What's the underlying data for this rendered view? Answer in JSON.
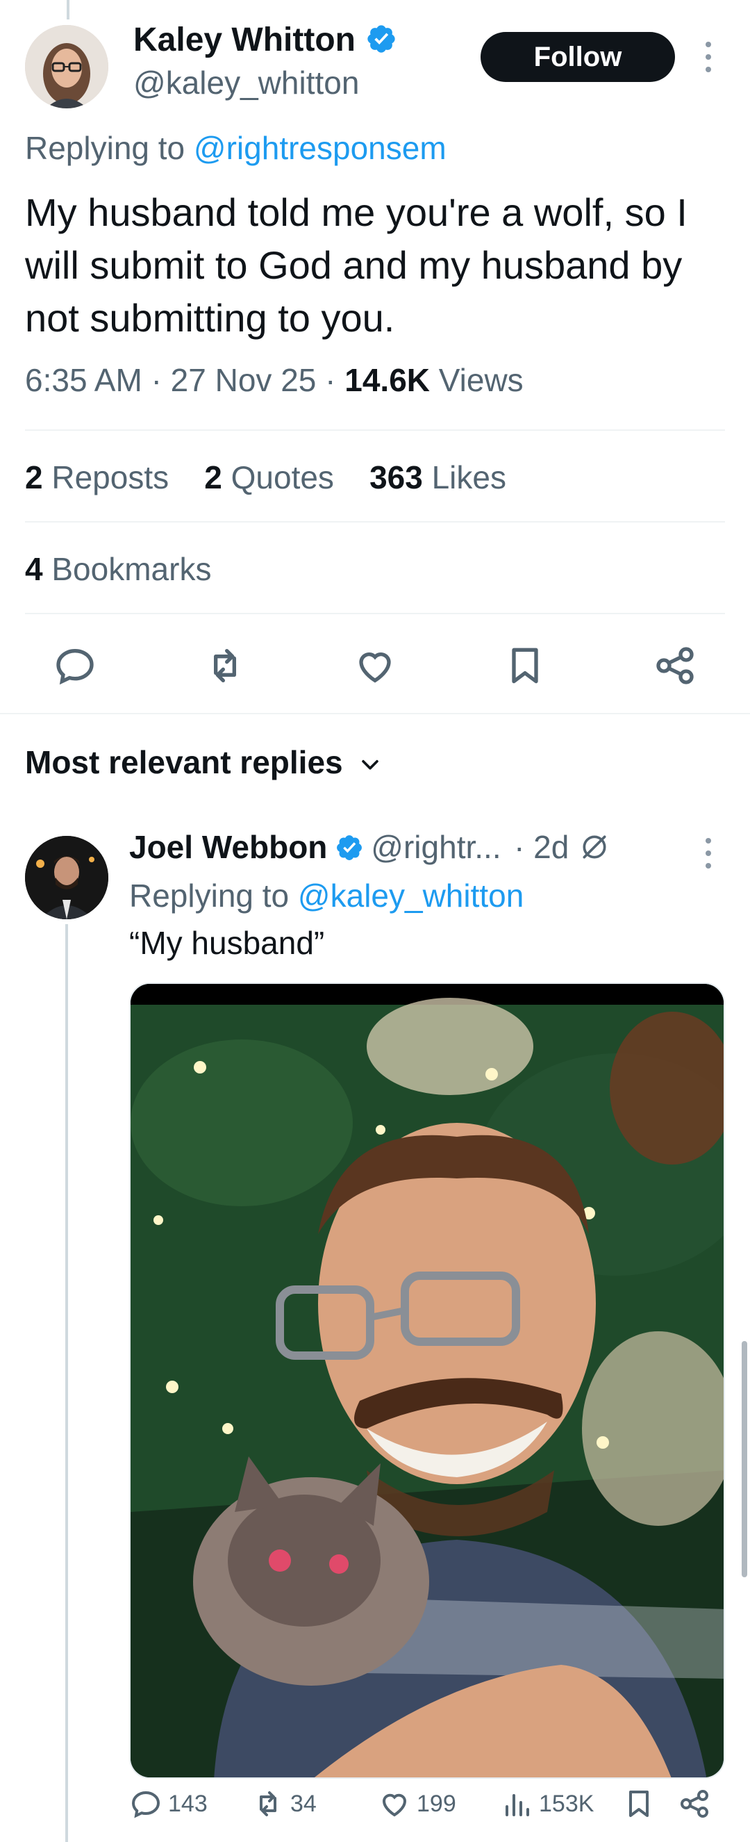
{
  "main_tweet": {
    "author_name": "Kaley Whitton",
    "author_handle": "@kaley_whitton",
    "follow_label": "Follow",
    "replying_prefix": "Replying to ",
    "replying_to": "@rightresponsem",
    "text": "My husband told me you're a wolf, so I will submit to God and my husband by not submitting to you.",
    "time": "6:35 AM",
    "date": "27 Nov 25",
    "views_count": "14.6K",
    "views_label": "Views",
    "reposts_count": "2",
    "reposts_label": "Reposts",
    "quotes_count": "2",
    "quotes_label": "Quotes",
    "likes_count": "363",
    "likes_label": "Likes",
    "bookmarks_count": "4",
    "bookmarks_label": "Bookmarks"
  },
  "replies_section": {
    "title": "Most relevant replies"
  },
  "reply": {
    "author_name": "Joel Webbon",
    "author_handle": "@rightr...",
    "age": "· 2d",
    "replying_prefix": "Replying to ",
    "replying_to": "@kaley_whitton",
    "text": "“My husband”",
    "replies_count": "143",
    "reposts_count": "34",
    "likes_count": "199",
    "views_count": "153K"
  },
  "colors": {
    "accent": "#1d9bf0",
    "text": "#0f1419",
    "secondary": "#536471",
    "divider": "#eff3f4"
  },
  "icons": [
    "verified-badge-icon",
    "more-icon",
    "reply-icon",
    "repost-icon",
    "like-icon",
    "bookmark-icon",
    "share-icon",
    "views-icon",
    "chevron-down-icon",
    "grok-icon"
  ]
}
